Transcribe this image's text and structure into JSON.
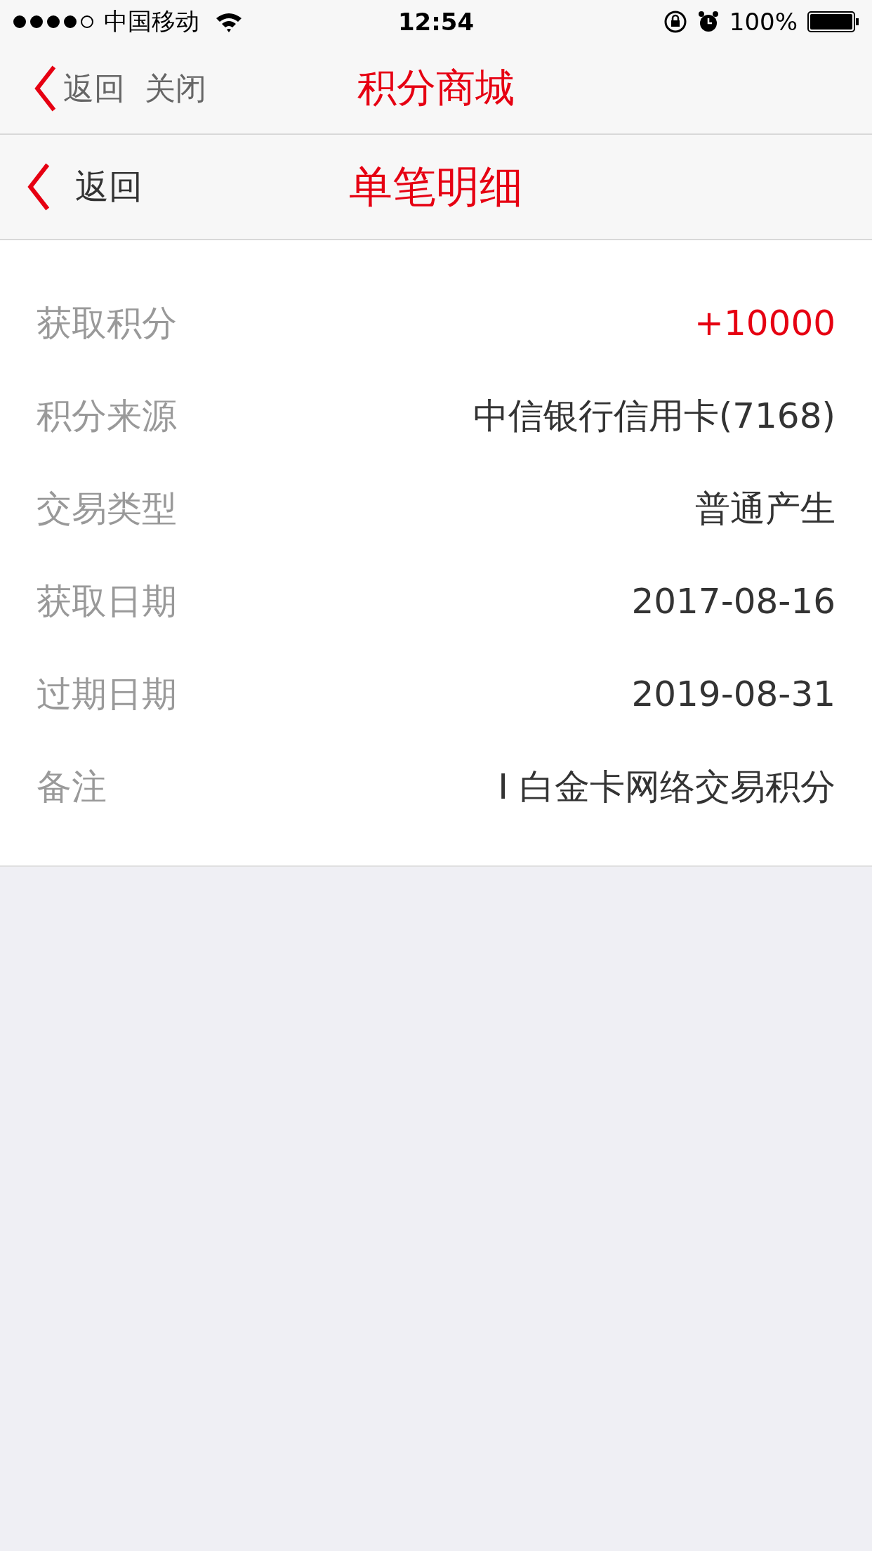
{
  "status_bar": {
    "carrier": "中国移动",
    "time": "12:54",
    "battery": "100%"
  },
  "outer_nav": {
    "back": "返回",
    "close": "关闭",
    "title": "积分商城"
  },
  "inner_nav": {
    "back": "返回",
    "title": "单笔明细"
  },
  "details": [
    {
      "label": "获取积分",
      "value": "+10000",
      "highlighted": true
    },
    {
      "label": "积分来源",
      "value": "中信银行信用卡(7168)",
      "highlighted": false
    },
    {
      "label": "交易类型",
      "value": "普通产生",
      "highlighted": false
    },
    {
      "label": "获取日期",
      "value": "2017-08-16",
      "highlighted": false
    },
    {
      "label": "过期日期",
      "value": "2019-08-31",
      "highlighted": false
    },
    {
      "label": "备注",
      "value": "I 白金卡网络交易积分",
      "highlighted": false
    }
  ]
}
